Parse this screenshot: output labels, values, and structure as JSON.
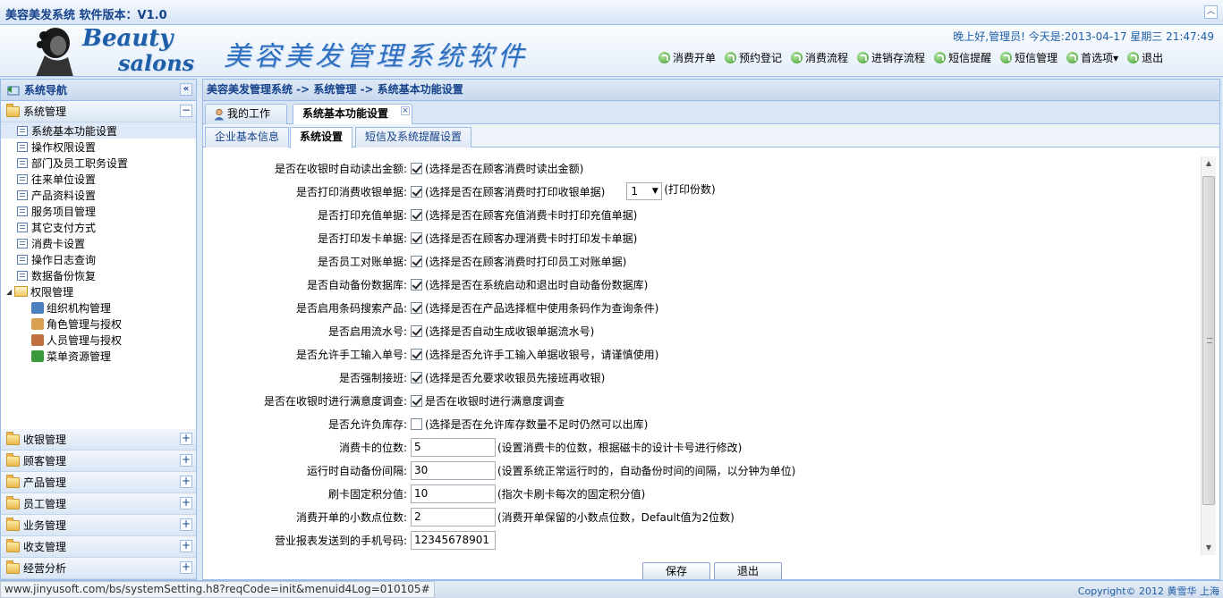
{
  "window": {
    "title": "美容美发系统 软件版本：V1.0"
  },
  "banner": {
    "logo_line1": "Beauty",
    "logo_line2": "salons",
    "title": "美容美发管理系统软件",
    "greeting": "晚上好,管理员! 今天是:2013-04-17 星期三 21:47:49"
  },
  "topnav": [
    {
      "label": "消费开单",
      "icon": "refresh-icon"
    },
    {
      "label": "预约登记",
      "icon": "arrow-circle-icon"
    },
    {
      "label": "消费流程",
      "icon": "arrow-circle-icon"
    },
    {
      "label": "进销存流程",
      "icon": "arrow-circle-icon"
    },
    {
      "label": "短信提醒",
      "icon": "arrow-circle-icon"
    },
    {
      "label": "短信管理",
      "icon": "arrow-circle-icon"
    },
    {
      "label": "首选项",
      "icon": "arrow-circle-icon"
    },
    {
      "label": "退出",
      "icon": "arrow-circle-icon"
    }
  ],
  "sidebar": {
    "header": "系统导航",
    "open_group": "系统管理",
    "items": [
      "系统基本功能设置",
      "操作权限设置",
      "部门及员工职务设置",
      "往来单位设置",
      "产品资料设置",
      "服务项目管理",
      "其它支付方式",
      "消费卡设置",
      "操作日志查询",
      "数据备份恢复"
    ],
    "sub_group": "权限管理",
    "sub_items": [
      "组织机构管理",
      "角色管理与授权",
      "人员管理与授权",
      "菜单资源管理"
    ],
    "groups": [
      "收银管理",
      "顾客管理",
      "产品管理",
      "员工管理",
      "业务管理",
      "收支管理",
      "经营分析"
    ]
  },
  "main": {
    "breadcrumb": "美容美发管理系统 -> 系统管理 -> 系统基本功能设置",
    "tabs": [
      "我的工作台",
      "系统基本功能设置"
    ],
    "subtabs": [
      "企业基本信息",
      "系统设置",
      "短信及系统提醒设置"
    ]
  },
  "settings": [
    {
      "label": "是否在收银时自动读出金额:",
      "checked": true,
      "desc": "(选择是否在顾客消费时读出金额)"
    },
    {
      "label": "是否打印消费收银单据:",
      "checked": true,
      "desc": "(选择是否在顾客消费时打印收银单据)",
      "select": "1",
      "select_desc": "(打印份数)"
    },
    {
      "label": "是否打印充值单据:",
      "checked": true,
      "desc": "(选择是否在顾客充值消费卡时打印充值单据)"
    },
    {
      "label": "是否打印发卡单据:",
      "checked": true,
      "desc": "(选择是否在顾客办理消费卡时打印发卡单据)"
    },
    {
      "label": "是否员工对账单据:",
      "checked": true,
      "desc": "(选择是否在顾客消费时打印员工对账单据)"
    },
    {
      "label": "是否自动备份数据库:",
      "checked": true,
      "desc": "(选择是否在系统启动和退出时自动备份数据库)"
    },
    {
      "label": "是否启用条码搜索产品:",
      "checked": true,
      "desc": "(选择是否在产品选择框中使用条码作为查询条件)"
    },
    {
      "label": "是否启用流水号:",
      "checked": true,
      "desc": "(选择是否自动生成收银单据流水号)"
    },
    {
      "label": "是否允许手工输入单号:",
      "checked": true,
      "desc": "(选择是否允许手工输入单据收银号，请谨慎使用)"
    },
    {
      "label": "是否强制接班:",
      "checked": true,
      "desc": "(选择是否允要求收银员先接班再收银)"
    },
    {
      "label": "是否在收银时进行满意度调查:",
      "checked": true,
      "desc": "是否在收银时进行满意度调查"
    },
    {
      "label": "是否允许负库存:",
      "checked": false,
      "desc": "(选择是否在允许库存数量不足时仍然可以出库)"
    }
  ],
  "inputs": [
    {
      "label": "消费卡的位数:",
      "value": "5",
      "desc": "(设置消费卡的位数，根据磁卡的设计卡号进行修改)"
    },
    {
      "label": "运行时自动备份间隔:",
      "value": "30",
      "desc": "(设置系统正常运行时的，自动备份时间的间隔，以分钟为单位)"
    },
    {
      "label": "刷卡固定积分值:",
      "value": "10",
      "desc": "(指次卡刷卡每次的固定积分值)"
    },
    {
      "label": "消费开单的小数点位数:",
      "value": "2",
      "desc": "(消费开单保留的小数点位数，Default值为2位数)"
    },
    {
      "label": "营业报表发送到的手机号码:",
      "value": "12345678901",
      "desc": ""
    }
  ],
  "buttons": {
    "save": "保存",
    "exit": "退出"
  },
  "statusbar": {
    "url": "www.jinyusoft.com/bs/systemSetting.h8?reqCode=init&menuid4Log=010105#",
    "copyright": "Copyright© 2012 黄雪华 上海"
  }
}
